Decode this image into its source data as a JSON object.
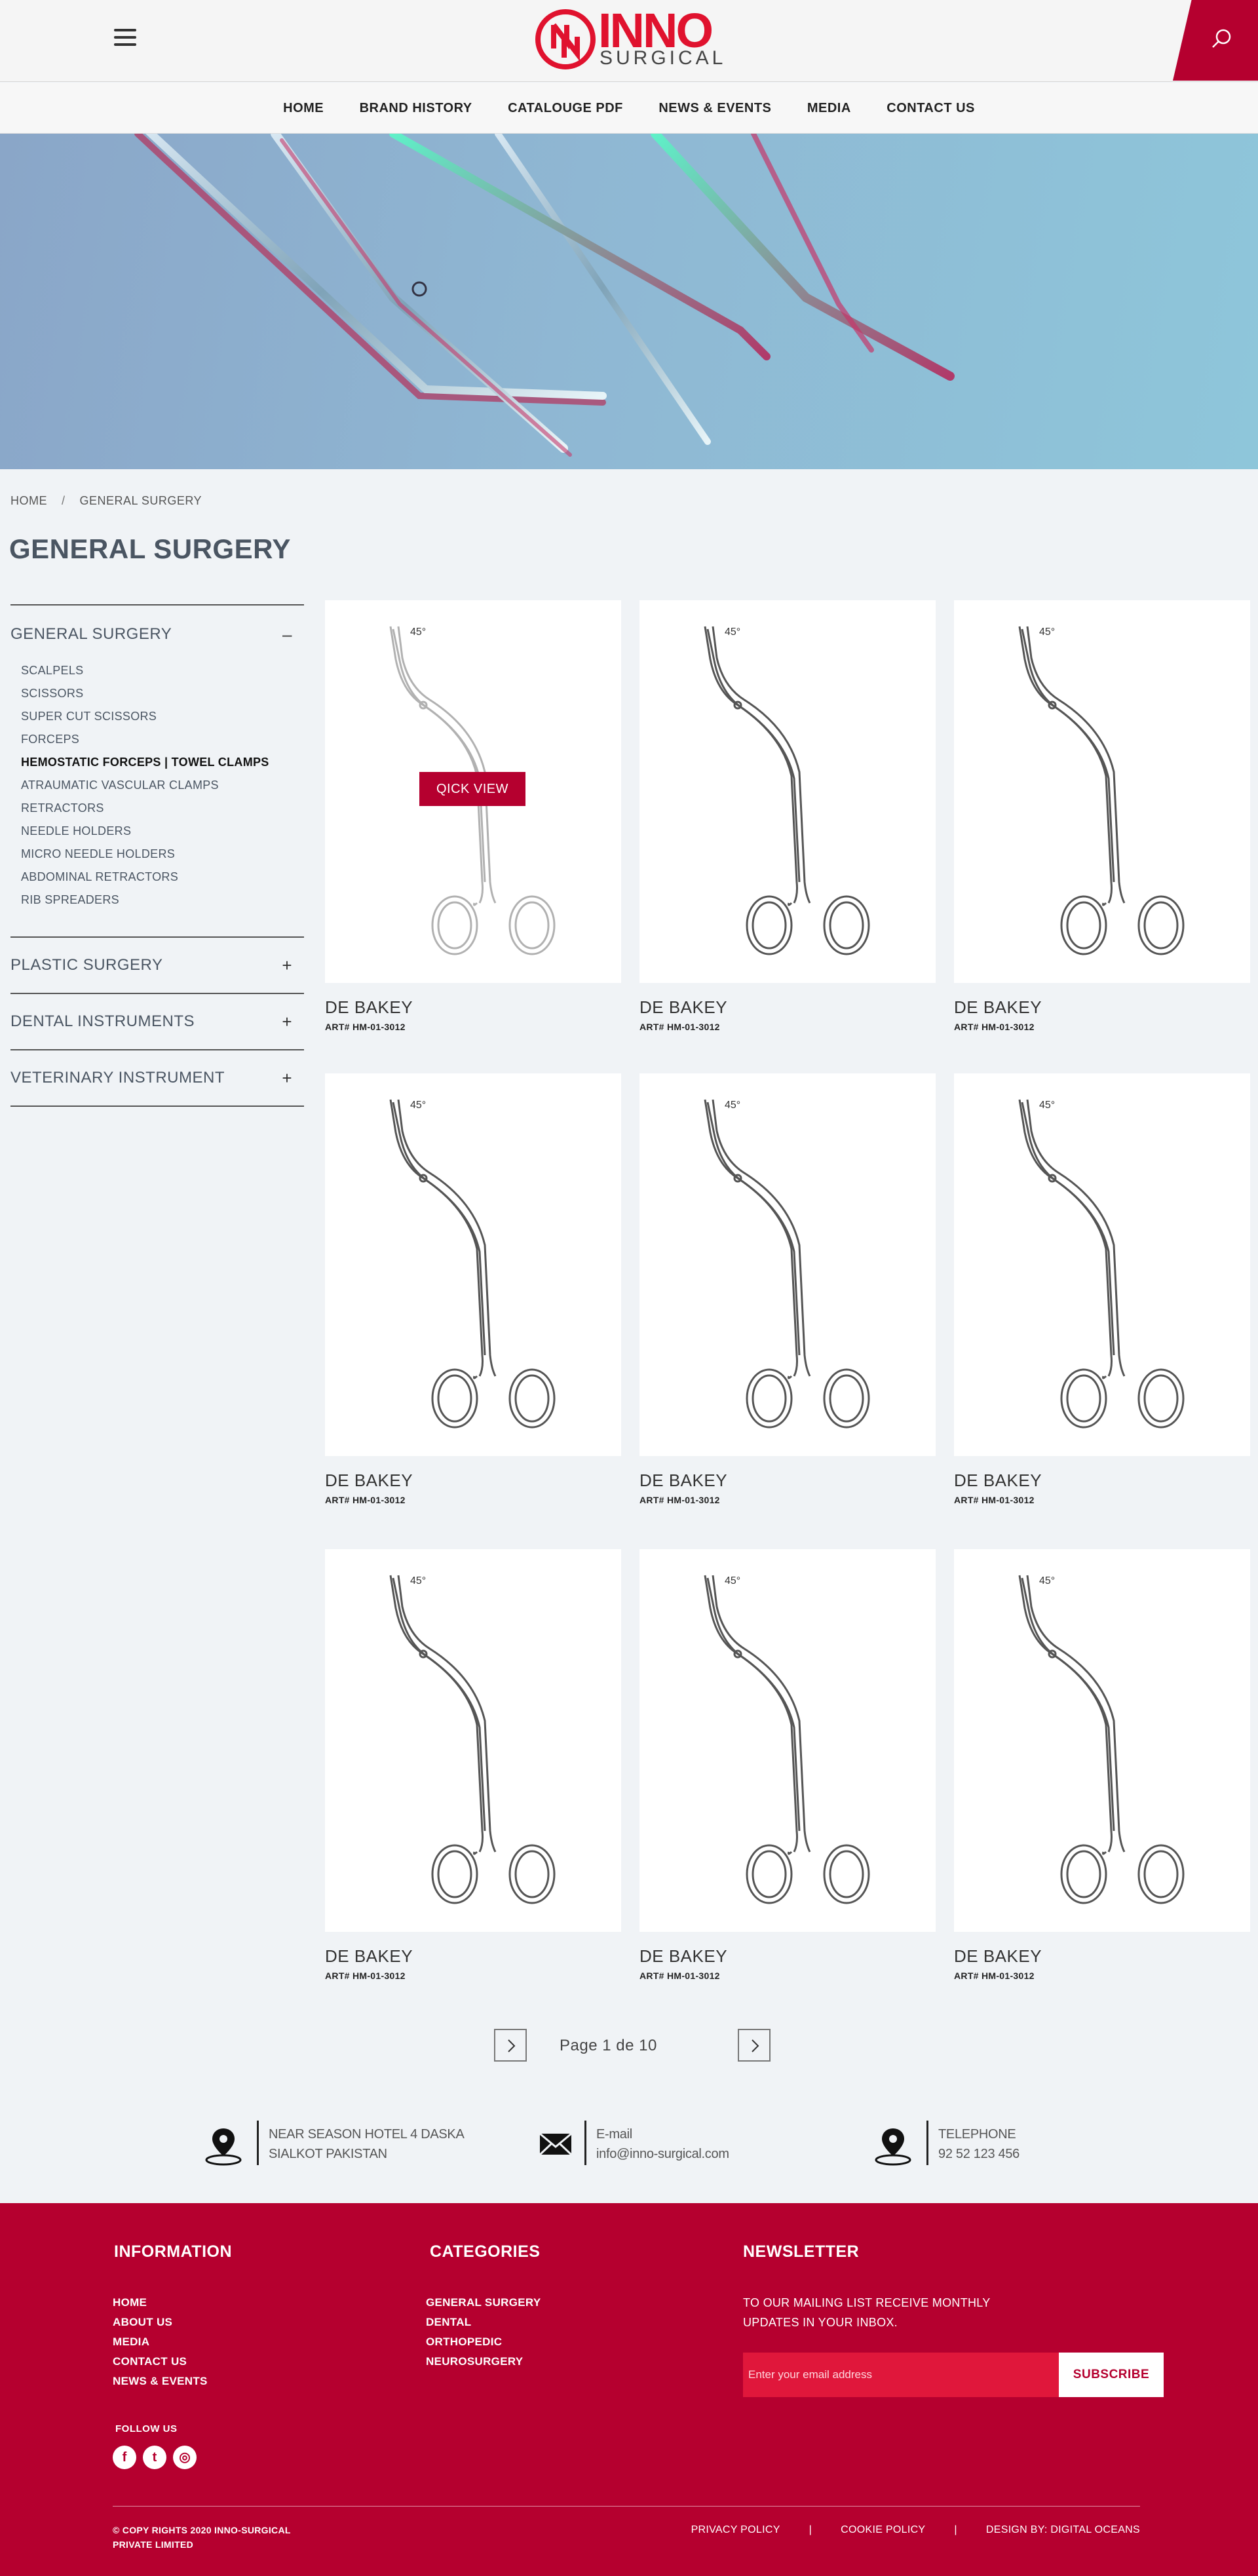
{
  "header": {
    "logo_main": "INNO",
    "logo_sub": "SURGICAL",
    "logo_colors": {
      "red": "#e0122e",
      "grey": "#444444"
    }
  },
  "nav": [
    "HOME",
    "BRAND HISTORY",
    "CATALOUGE PDF",
    "NEWS & EVENTS",
    "MEDIA",
    "CONTACT US"
  ],
  "breadcrumb": {
    "home": "HOME",
    "separator": "/",
    "current": "GENERAL SURGERY"
  },
  "page_title": "GENERAL SURGERY",
  "sidebar": {
    "categories": [
      {
        "label": "GENERAL SURGERY",
        "toggle": "–",
        "items": [
          "SCALPELS",
          "SCISSORS",
          "SUPER CUT SCISSORS",
          "FORCEPS",
          "HEMOSTATIC FORCEPS | TOWEL CLAMPS",
          "ATRAUMATIC VASCULAR CLAMPS",
          "RETRACTORS",
          "NEEDLE HOLDERS",
          "MICRO NEEDLE HOLDERS",
          "ABDOMINAL RETRACTORS",
          "RIB SPREADERS"
        ],
        "active_item": "HEMOSTATIC FORCEPS | TOWEL CLAMPS"
      },
      {
        "label": "PLASTIC SURGERY",
        "toggle": "+"
      },
      {
        "label": "DENTAL INSTRUMENTS",
        "toggle": "+"
      },
      {
        "label": "VETERINARY INSTRUMENT",
        "toggle": "+"
      }
    ]
  },
  "products": [
    {
      "name": "DE BAKEY",
      "art": "ART# HM-01-3012",
      "angle": "45°",
      "quick_view": "QICK VIEW"
    },
    {
      "name": "DE BAKEY",
      "art": "ART# HM-01-3012",
      "angle": "45°"
    },
    {
      "name": "DE BAKEY",
      "art": "ART# HM-01-3012",
      "angle": "45°"
    },
    {
      "name": "DE BAKEY",
      "art": "ART# HM-01-3012",
      "angle": "45°"
    },
    {
      "name": "DE BAKEY",
      "art": "ART# HM-01-3012",
      "angle": "45°"
    },
    {
      "name": "DE BAKEY",
      "art": "ART# HM-01-3012",
      "angle": "45°"
    },
    {
      "name": "DE BAKEY",
      "art": "ART# HM-01-3012",
      "angle": "45°"
    },
    {
      "name": "DE BAKEY",
      "art": "ART# HM-01-3012",
      "angle": "45°"
    },
    {
      "name": "DE BAKEY",
      "art": "ART# HM-01-3012",
      "angle": "45°"
    }
  ],
  "pagination": {
    "text": "Page 1 de 10"
  },
  "contacts": {
    "address": {
      "line1": "NEAR SEASON HOTEL 4 DASKA",
      "line2": "SIALKOT PAKISTAN",
      "icon": "location-pin-icon"
    },
    "email": {
      "line1": "E-mail",
      "line2": "info@inno-surgical.com",
      "icon": "envelope-icon"
    },
    "phone": {
      "line1": "TELEPHONE",
      "line2": "92 52 123 456",
      "icon": "location-pin-icon"
    }
  },
  "footer": {
    "information": {
      "title": "INFORMATION",
      "links": [
        "HOME",
        "ABOUT US",
        "MEDIA",
        "CONTACT US",
        "NEWS & EVENTS"
      ]
    },
    "follow_us": "FOLLOW US",
    "social": [
      {
        "icon": "facebook-icon",
        "glyph": "f"
      },
      {
        "icon": "twitter-icon",
        "glyph": "t"
      },
      {
        "icon": "instagram-icon",
        "glyph": "◎"
      }
    ],
    "categories": {
      "title": "CATEGORIES",
      "links": [
        "GENERAL SURGERY",
        "DENTAL",
        "ORTHOPEDIC",
        "NEUROSURGERY"
      ]
    },
    "newsletter": {
      "title": "NEWSLETTER",
      "text": "TO OUR MAILING LIST RECEIVE MONTHLY UPDATES IN YOUR INBOX.",
      "placeholder": "Enter your email address",
      "button": "SUBSCRIBE"
    },
    "copyright": "© COPY RIGHTS 2020  INNO-SURGICAL PRIVATE LIMITED",
    "bottom_links": [
      "PRIVACY POLICY",
      "COOKIE POLICY",
      "DESIGN BY: DIGITAL OCEANS"
    ],
    "bottom_separator": "|"
  },
  "colors": {
    "brand": "#b5002f",
    "accent": "#e0122e",
    "page_bg": "#f0f3f6"
  }
}
